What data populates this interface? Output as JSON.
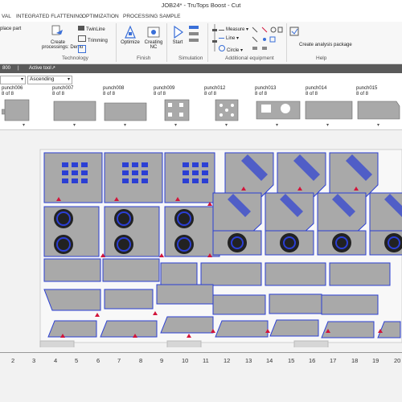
{
  "window": {
    "title": "JOB24* - TruTops Boost - Cut"
  },
  "tabs": [
    "VAL",
    "INTEGRATED FLATTENING",
    "OPTIMIZATION",
    "PROCESSING SAMPLE"
  ],
  "ribbon": {
    "place_part": "place part",
    "create_processings_l1": "Create",
    "create_processings_l2": "processings: Demo",
    "twinline": "TwinLine",
    "trimming": "Trimming",
    "technology": "Technology",
    "optimize": "Optimize",
    "creating_nc_l1": "Creating",
    "creating_nc_l2": "NC",
    "finish": "Finish",
    "start": "Start",
    "simulation": "Simulation",
    "measure": "Measure",
    "line": "Line",
    "circle": "Circle",
    "additional_equipment": "Additional equipment",
    "create_analysis_package": "Create analysis package",
    "help": "Help"
  },
  "statusbar": {
    "left_value": "800",
    "active_tool": "Active tool"
  },
  "sort": {
    "order": "Ascending"
  },
  "punches": [
    {
      "name": "punch006",
      "count": "8 of 8"
    },
    {
      "name": "punch007",
      "count": "8 of 8"
    },
    {
      "name": "punch008",
      "count": "8 of 8"
    },
    {
      "name": "punch009",
      "count": "8 of 8"
    },
    {
      "name": "punch012",
      "count": "8 of 8"
    },
    {
      "name": "punch013",
      "count": "8 of 8"
    },
    {
      "name": "punch014",
      "count": "8 of 8"
    },
    {
      "name": "punch015",
      "count": "8 of 8"
    }
  ],
  "ruler": [
    "2",
    "3",
    "4",
    "5",
    "6",
    "7",
    "8",
    "9",
    "10",
    "11",
    "12",
    "13",
    "14",
    "15",
    "16",
    "17",
    "18",
    "19",
    "20"
  ],
  "colors": {
    "part_fill": "#a9a9a9",
    "contour": "#2b3fd4",
    "marker": "#d2143a",
    "clamp": "#f2c200",
    "statusbar": "#5a5a5a"
  }
}
